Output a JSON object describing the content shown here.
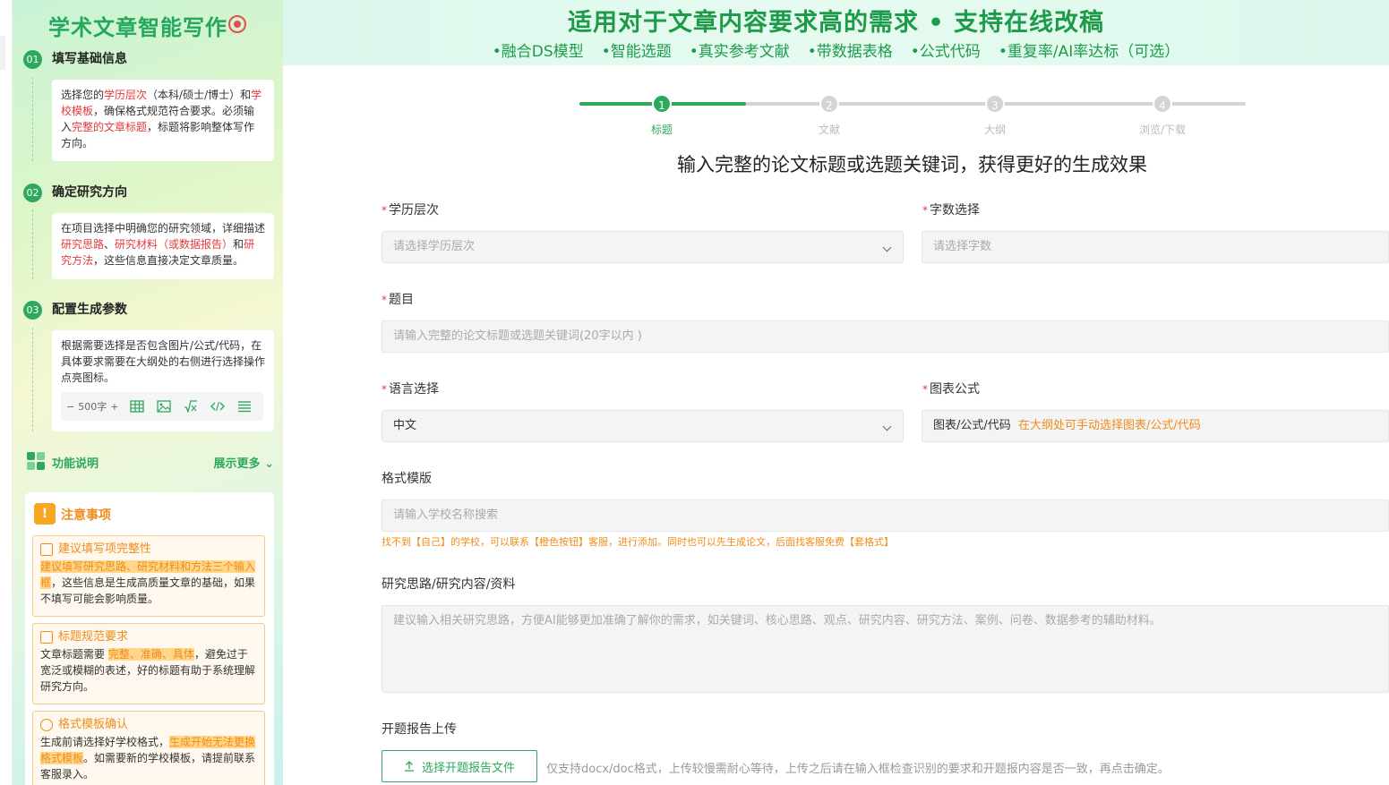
{
  "sidebar": {
    "brand_title": "学术文章智能写作",
    "steps": [
      {
        "num": "01",
        "title": "填写基础信息",
        "desc": [
          {
            "t": "选择您的",
            "red": false
          },
          {
            "t": "学历层次",
            "red": true
          },
          {
            "t": "（本科/硕士/博士）和",
            "red": false
          },
          {
            "t": "学校模板",
            "red": true
          },
          {
            "t": "，确保格式规范符合要求。必须输入",
            "red": false
          },
          {
            "t": "完整的文章标题",
            "red": true
          },
          {
            "t": "，标题将影响整体写作方向。",
            "red": false
          }
        ]
      },
      {
        "num": "02",
        "title": "确定研究方向",
        "desc": [
          {
            "t": "在项目选择中明确您的研究领域，详细描述",
            "red": false
          },
          {
            "t": "研究思路",
            "red": true
          },
          {
            "t": "、",
            "red": false
          },
          {
            "t": "研究材料（或数据报告）",
            "red": true
          },
          {
            "t": "和",
            "red": false
          },
          {
            "t": "研究方法",
            "red": true
          },
          {
            "t": "，这些信息直接决定文章质量。",
            "red": false
          }
        ]
      },
      {
        "num": "03",
        "title": "配置生成参数",
        "desc": [
          {
            "t": "根据需要选择是否包含图片/公式/代码，在具体要求需要在大纲处的右侧进行选择操作点亮图标。",
            "red": false
          }
        ]
      }
    ],
    "param_row": {
      "minus": "−",
      "word_count": "500字",
      "plus": "+"
    },
    "func": {
      "label": "功能说明",
      "more": "展示更多"
    },
    "notice": {
      "title": "注意事项",
      "boxes": [
        {
          "title": "建议填写项完整性",
          "body": [
            {
              "t": "建议填写研究思路、研究材料和方法三个输入框",
              "hl": true
            },
            {
              "t": "，这些信息是生成高质量文章的基础，如果不填写可能会影响质量。",
              "hl": false
            }
          ]
        },
        {
          "title": "标题规范要求",
          "body": [
            {
              "t": "文章标题需要 ",
              "hl": false
            },
            {
              "t": "完整、准确、具体",
              "hl": true
            },
            {
              "t": "，避免过于宽泛或模糊的表述，好的标题有助于系统理解研究方向。",
              "hl": false
            }
          ]
        },
        {
          "title": "格式模板确认",
          "body": [
            {
              "t": "生成前请选择好学校格式，",
              "hl": false
            },
            {
              "t": "生成开始无法更换格式模板",
              "hl": true
            },
            {
              "t": "。如需要新的学校模板，请提前联系客服录入。",
              "hl": false
            }
          ]
        }
      ]
    }
  },
  "banner": {
    "title": "适用对于文章内容要求高的需求 • 支持在线改稿",
    "features": [
      "•融合DS模型",
      "•智能选题",
      "•真实参考文献",
      "•带数据表格",
      "•公式代码",
      "•重复率/AI率达标（可选）"
    ]
  },
  "progress": {
    "current_fraction": 0.25,
    "steps": [
      {
        "num": "1",
        "label": "标题",
        "active": true
      },
      {
        "num": "2",
        "label": "文献",
        "active": false
      },
      {
        "num": "3",
        "label": "大纲",
        "active": false
      },
      {
        "num": "4",
        "label": "浏览/下载",
        "active": false
      }
    ]
  },
  "form": {
    "headline": "输入完整的论文标题或选题关键词，获得更好的生成效果",
    "required_mark": "*",
    "education": {
      "label": "学历层次",
      "placeholder": "请选择学历层次"
    },
    "word_count": {
      "label": "字数选择",
      "placeholder": "请选择字数"
    },
    "topic": {
      "label": "题目",
      "placeholder": "请输入完整的论文标题或选题关键词(20字以内 )"
    },
    "language": {
      "label": "语言选择",
      "value": "中文"
    },
    "charts": {
      "label": "图表公式",
      "value": "图表/公式/代码",
      "note": "在大纲处可手动选择图表/公式/代码"
    },
    "template": {
      "label": "格式模版",
      "placeholder": "请输入学校名称搜索",
      "hint": "找不到【自己】的学校，可以联系【橙色按钮】客服，进行添加。同时也可以先生成论文，后面找客服免费【套格式】"
    },
    "research": {
      "label": "研究思路/研究内容/资料",
      "placeholder": "建议输入相关研究思路，方便AI能够更加准确了解你的需求，如关键词、核心思路、观点、研究内容、研究方法、案例、问卷、数据参考的辅助材料。"
    },
    "upload": {
      "label": "开题报告上传",
      "button": "选择开题报告文件",
      "note": "仅支持docx/doc格式，上传较慢需耐心等待，上传之后请在输入框检查识别的要求和开题报内容是否一致，再点击确定。"
    }
  },
  "colors": {
    "accent": "#2ea85c",
    "warning": "#f08c1a",
    "required": "#e4393c"
  }
}
